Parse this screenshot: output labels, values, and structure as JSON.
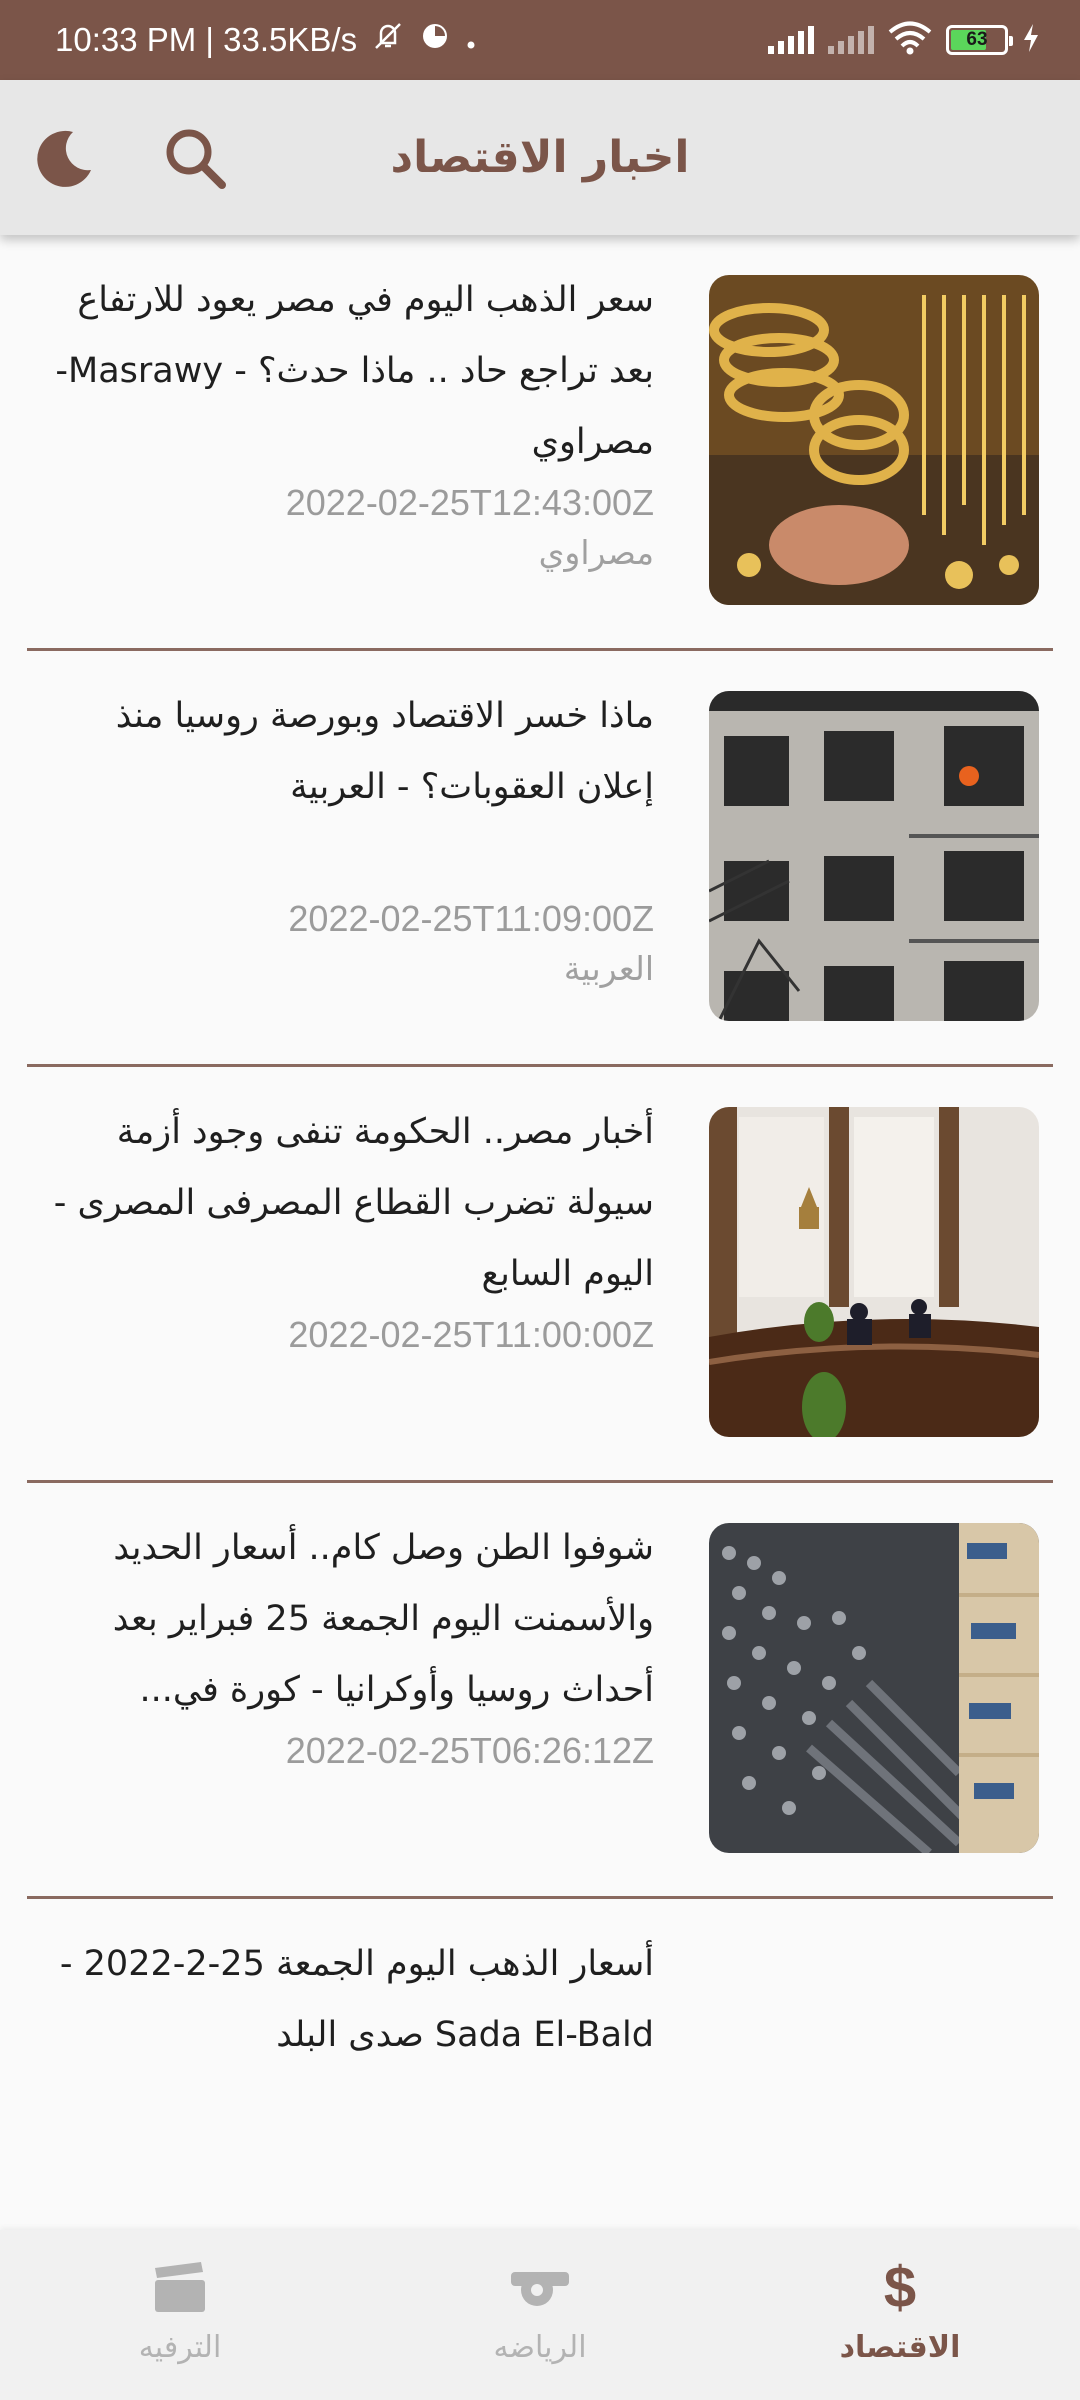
{
  "status_bar": {
    "time_speed": "10:33 PM | 33.5KB/s",
    "battery_level": "63",
    "battery_fraction": 0.63
  },
  "app_bar": {
    "title": "اخبار الاقتصاد",
    "icons": [
      "moon-icon",
      "search-icon"
    ]
  },
  "articles": [
    {
      "title": "سعر الذهب اليوم في مصر يعود للارتفاع بعد تراجع حاد .. ماذا حدث؟ - Masrawy-مصراوي",
      "date": "2022-02-25T12:43:00Z",
      "source": "مصراوي",
      "image": "gold-jewelry"
    },
    {
      "title": "ماذا خسر الاقتصاد وبورصة روسيا منذ إعلان العقوبات؟ - العربية",
      "date": "2022-02-25T11:09:00Z",
      "source": "العربية",
      "image": "damaged-building"
    },
    {
      "title": "أخبار مصر.. الحكومة تنفى وجود أزمة سيولة تضرب القطاع المصرفى المصرى - اليوم السابع",
      "date": "2022-02-25T11:00:00Z",
      "source": "",
      "image": "cabinet-meeting"
    },
    {
      "title": "شوفوا الطن وصل كام.. أسعار الحديد والأسمنت اليوم الجمعة 25 فبراير بعد أحداث روسيا وأوكرانيا - كورة في...",
      "date": "2022-02-25T06:26:12Z",
      "source": "",
      "image": "steel-bars-cement"
    },
    {
      "title": "أسعار الذهب اليوم الجمعة 25-2-2022 - Sada El-Bald صدى البلد",
      "date": "",
      "source": "",
      "image": ""
    }
  ],
  "bottom_nav": {
    "items": [
      {
        "label": "الترفيه",
        "icon": "clapperboard-icon",
        "active": false
      },
      {
        "label": "الرياضه",
        "icon": "whistle-icon",
        "active": false
      },
      {
        "label": "الاقتصاد",
        "icon": "dollar-icon",
        "active": true
      }
    ]
  },
  "colors": {
    "primary": "#7b5549",
    "app_bar_bg": "#e7e7e7",
    "background": "#fafafa",
    "muted_text": "#9b9b9b"
  }
}
